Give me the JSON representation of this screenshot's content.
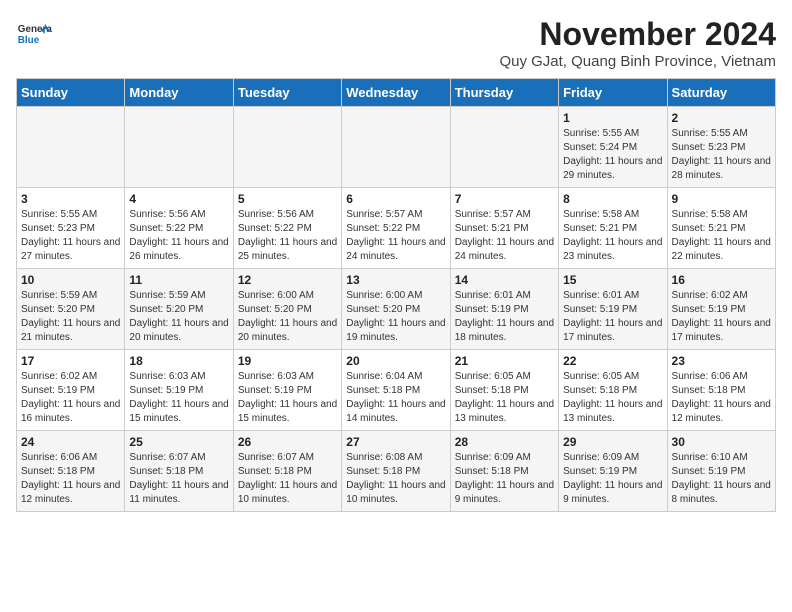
{
  "logo": {
    "text_general": "General",
    "text_blue": "Blue"
  },
  "header": {
    "month_title": "November 2024",
    "subtitle": "Quy GJat, Quang Binh Province, Vietnam"
  },
  "weekdays": [
    "Sunday",
    "Monday",
    "Tuesday",
    "Wednesday",
    "Thursday",
    "Friday",
    "Saturday"
  ],
  "weeks": [
    [
      {
        "day": "",
        "info": ""
      },
      {
        "day": "",
        "info": ""
      },
      {
        "day": "",
        "info": ""
      },
      {
        "day": "",
        "info": ""
      },
      {
        "day": "",
        "info": ""
      },
      {
        "day": "1",
        "info": "Sunrise: 5:55 AM\nSunset: 5:24 PM\nDaylight: 11 hours and 29 minutes."
      },
      {
        "day": "2",
        "info": "Sunrise: 5:55 AM\nSunset: 5:23 PM\nDaylight: 11 hours and 28 minutes."
      }
    ],
    [
      {
        "day": "3",
        "info": "Sunrise: 5:55 AM\nSunset: 5:23 PM\nDaylight: 11 hours and 27 minutes."
      },
      {
        "day": "4",
        "info": "Sunrise: 5:56 AM\nSunset: 5:22 PM\nDaylight: 11 hours and 26 minutes."
      },
      {
        "day": "5",
        "info": "Sunrise: 5:56 AM\nSunset: 5:22 PM\nDaylight: 11 hours and 25 minutes."
      },
      {
        "day": "6",
        "info": "Sunrise: 5:57 AM\nSunset: 5:22 PM\nDaylight: 11 hours and 24 minutes."
      },
      {
        "day": "7",
        "info": "Sunrise: 5:57 AM\nSunset: 5:21 PM\nDaylight: 11 hours and 24 minutes."
      },
      {
        "day": "8",
        "info": "Sunrise: 5:58 AM\nSunset: 5:21 PM\nDaylight: 11 hours and 23 minutes."
      },
      {
        "day": "9",
        "info": "Sunrise: 5:58 AM\nSunset: 5:21 PM\nDaylight: 11 hours and 22 minutes."
      }
    ],
    [
      {
        "day": "10",
        "info": "Sunrise: 5:59 AM\nSunset: 5:20 PM\nDaylight: 11 hours and 21 minutes."
      },
      {
        "day": "11",
        "info": "Sunrise: 5:59 AM\nSunset: 5:20 PM\nDaylight: 11 hours and 20 minutes."
      },
      {
        "day": "12",
        "info": "Sunrise: 6:00 AM\nSunset: 5:20 PM\nDaylight: 11 hours and 20 minutes."
      },
      {
        "day": "13",
        "info": "Sunrise: 6:00 AM\nSunset: 5:20 PM\nDaylight: 11 hours and 19 minutes."
      },
      {
        "day": "14",
        "info": "Sunrise: 6:01 AM\nSunset: 5:19 PM\nDaylight: 11 hours and 18 minutes."
      },
      {
        "day": "15",
        "info": "Sunrise: 6:01 AM\nSunset: 5:19 PM\nDaylight: 11 hours and 17 minutes."
      },
      {
        "day": "16",
        "info": "Sunrise: 6:02 AM\nSunset: 5:19 PM\nDaylight: 11 hours and 17 minutes."
      }
    ],
    [
      {
        "day": "17",
        "info": "Sunrise: 6:02 AM\nSunset: 5:19 PM\nDaylight: 11 hours and 16 minutes."
      },
      {
        "day": "18",
        "info": "Sunrise: 6:03 AM\nSunset: 5:19 PM\nDaylight: 11 hours and 15 minutes."
      },
      {
        "day": "19",
        "info": "Sunrise: 6:03 AM\nSunset: 5:19 PM\nDaylight: 11 hours and 15 minutes."
      },
      {
        "day": "20",
        "info": "Sunrise: 6:04 AM\nSunset: 5:18 PM\nDaylight: 11 hours and 14 minutes."
      },
      {
        "day": "21",
        "info": "Sunrise: 6:05 AM\nSunset: 5:18 PM\nDaylight: 11 hours and 13 minutes."
      },
      {
        "day": "22",
        "info": "Sunrise: 6:05 AM\nSunset: 5:18 PM\nDaylight: 11 hours and 13 minutes."
      },
      {
        "day": "23",
        "info": "Sunrise: 6:06 AM\nSunset: 5:18 PM\nDaylight: 11 hours and 12 minutes."
      }
    ],
    [
      {
        "day": "24",
        "info": "Sunrise: 6:06 AM\nSunset: 5:18 PM\nDaylight: 11 hours and 12 minutes."
      },
      {
        "day": "25",
        "info": "Sunrise: 6:07 AM\nSunset: 5:18 PM\nDaylight: 11 hours and 11 minutes."
      },
      {
        "day": "26",
        "info": "Sunrise: 6:07 AM\nSunset: 5:18 PM\nDaylight: 11 hours and 10 minutes."
      },
      {
        "day": "27",
        "info": "Sunrise: 6:08 AM\nSunset: 5:18 PM\nDaylight: 11 hours and 10 minutes."
      },
      {
        "day": "28",
        "info": "Sunrise: 6:09 AM\nSunset: 5:18 PM\nDaylight: 11 hours and 9 minutes."
      },
      {
        "day": "29",
        "info": "Sunrise: 6:09 AM\nSunset: 5:19 PM\nDaylight: 11 hours and 9 minutes."
      },
      {
        "day": "30",
        "info": "Sunrise: 6:10 AM\nSunset: 5:19 PM\nDaylight: 11 hours and 8 minutes."
      }
    ]
  ]
}
